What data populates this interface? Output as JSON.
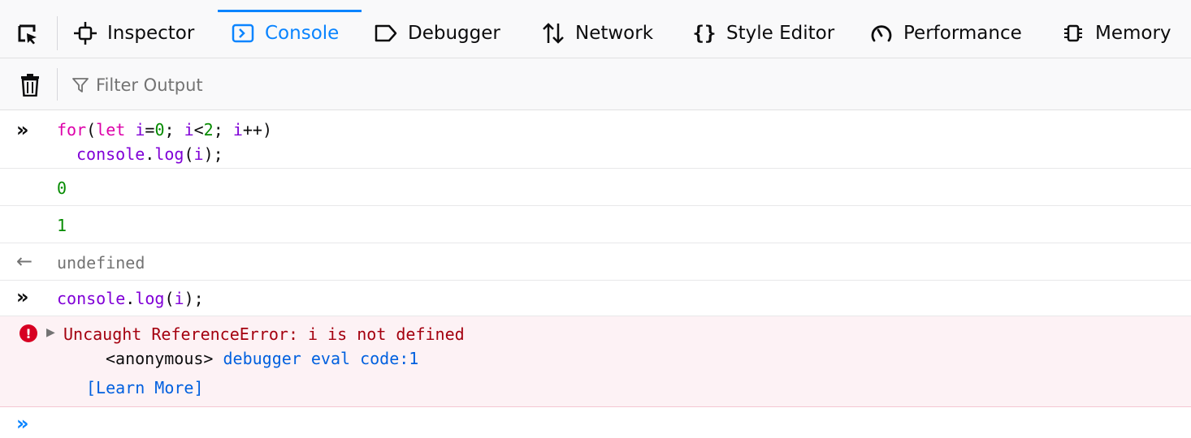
{
  "toolbar": {
    "tabs": [
      {
        "label": "Inspector",
        "icon": "inspector-icon"
      },
      {
        "label": "Console",
        "icon": "console-icon",
        "selected": true
      },
      {
        "label": "Debugger",
        "icon": "debugger-icon"
      },
      {
        "label": "Network",
        "icon": "network-icon"
      },
      {
        "label": "Style Editor",
        "icon": "style-editor-icon"
      },
      {
        "label": "Performance",
        "icon": "performance-icon"
      },
      {
        "label": "Memory",
        "icon": "memory-icon"
      }
    ],
    "accent_color": "#0a84ff"
  },
  "filter": {
    "placeholder": "Filter Output"
  },
  "console": {
    "input1": {
      "line1": {
        "kw": "for",
        "p1": "(",
        "kw2": "let",
        "v1": " i",
        "p2": "=",
        "n1": "0",
        "p3": "; ",
        "v2": "i",
        "p4": "<",
        "n2": "2",
        "p5": "; ",
        "v3": "i",
        "p6": "++)"
      },
      "line2": {
        "obj": "console",
        "dot": ".",
        "fn": "log",
        "p1": "(",
        "arg": "i",
        "p2": ");"
      }
    },
    "output": [
      "0",
      "1"
    ],
    "result": "undefined",
    "input2": {
      "obj": "console",
      "dot": ".",
      "fn": "log",
      "p1": "(",
      "arg": "i",
      "p2": ");"
    },
    "error": {
      "message": "Uncaught ReferenceError: i is not defined",
      "frame_name": "<anonymous>",
      "frame_location": "debugger eval code:1",
      "learn_more": "[Learn More]"
    }
  },
  "colors": {
    "keyword": "#dd00a9",
    "identifier": "#8000d7",
    "number": "#058b00",
    "error": "#a4000f",
    "error_bg": "#fdf2f5",
    "link": "#0060df"
  }
}
